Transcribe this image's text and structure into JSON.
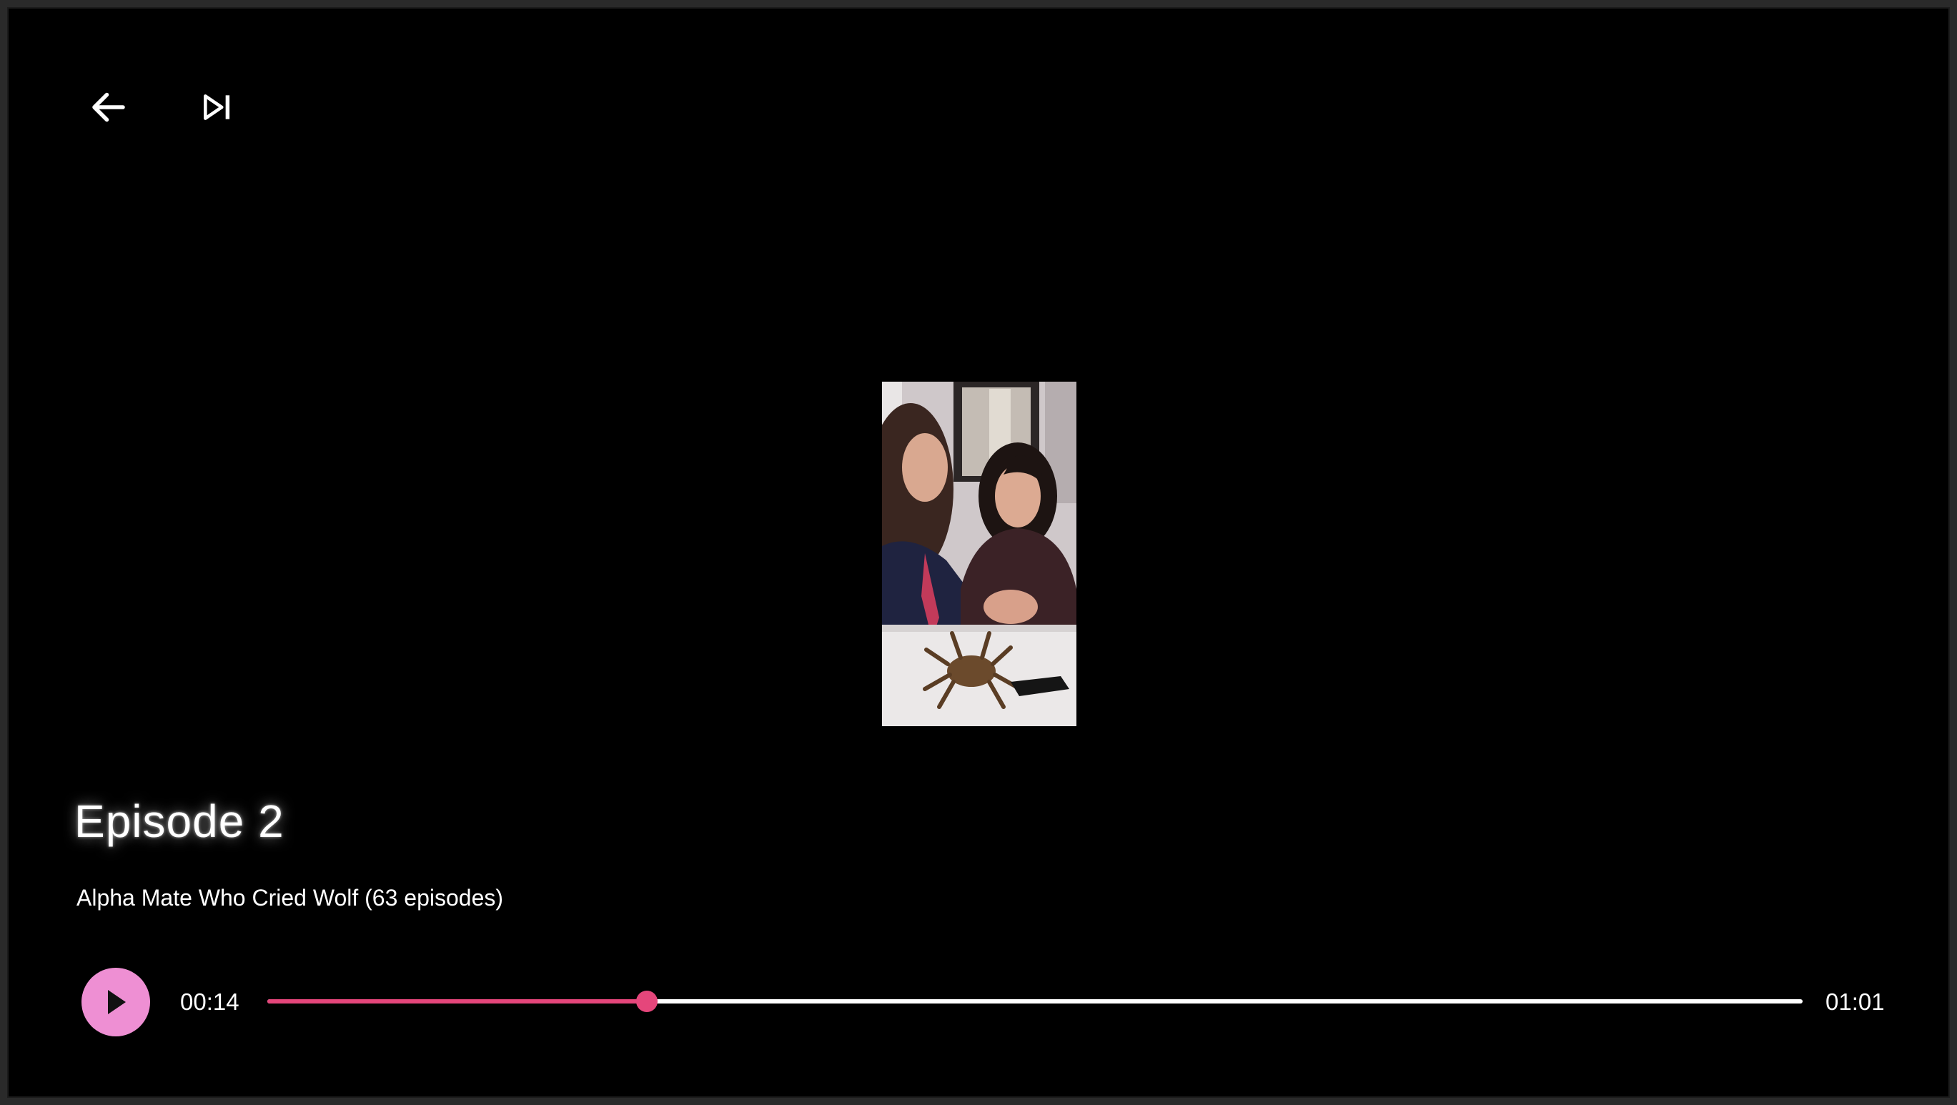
{
  "episode": {
    "title": "Episode 2",
    "series_line": "Alpha Mate Who Cried Wolf (63 episodes)"
  },
  "top_controls": {
    "back_icon": "arrow-left-icon",
    "next_icon": "skip-next-icon"
  },
  "player": {
    "play_icon": "play-icon",
    "current_time": "00:14",
    "total_time": "01:01",
    "progress_fraction": 0.247
  },
  "colors": {
    "accent": "#e5467b",
    "play_button": "#ee8fd3",
    "background": "#000000",
    "text": "#ffffff"
  }
}
